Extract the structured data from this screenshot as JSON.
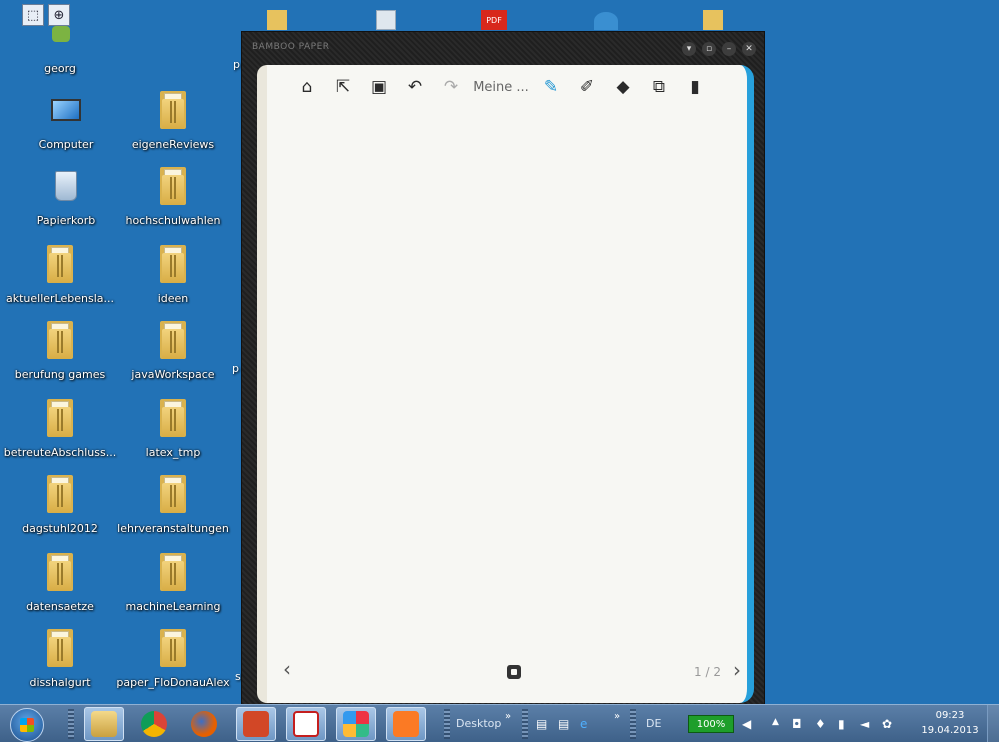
{
  "desktop": {
    "icons_col1": [
      {
        "label": "georg",
        "icon": "user-icon"
      },
      {
        "label": "Computer",
        "icon": "computer-icon"
      },
      {
        "label": "Papierkorb",
        "icon": "recycle-bin-icon"
      },
      {
        "label": "aktuellerLebensla...",
        "icon": "folder-icon"
      },
      {
        "label": "berufung games",
        "icon": "folder-icon"
      },
      {
        "label": "betreuteAbschluss...",
        "icon": "folder-icon"
      },
      {
        "label": "dagstuhl2012",
        "icon": "folder-icon"
      },
      {
        "label": "datensaetze",
        "icon": "folder-icon"
      },
      {
        "label": "disshalgurt",
        "icon": "folder-icon"
      }
    ],
    "icons_col2": [
      {
        "label": "eigeneReviews",
        "icon": "folder-icon"
      },
      {
        "label": "hochschulwahlen",
        "icon": "folder-icon"
      },
      {
        "label": "ideen",
        "icon": "folder-icon"
      },
      {
        "label": "javaWorkspace",
        "icon": "folder-icon"
      },
      {
        "label": "latex_tmp",
        "icon": "folder-icon"
      },
      {
        "label": "lehrveranstaltungen",
        "icon": "folder-icon"
      },
      {
        "label": "machineLearning",
        "icon": "folder-icon"
      },
      {
        "label": "paper_FloDonauAlex",
        "icon": "folder-icon"
      }
    ],
    "clipped_letters": [
      "p",
      "p",
      "s"
    ],
    "pdf_badge": "PDF"
  },
  "bamboo": {
    "title": "BAMBOO PAPER",
    "notebook_name": "Meine ...",
    "page_indicator": "1 / 2"
  },
  "taskbar": {
    "desktop_label": "Desktop",
    "language": "DE",
    "battery": "100%",
    "time": "09:23",
    "date": "19.04.2013"
  }
}
